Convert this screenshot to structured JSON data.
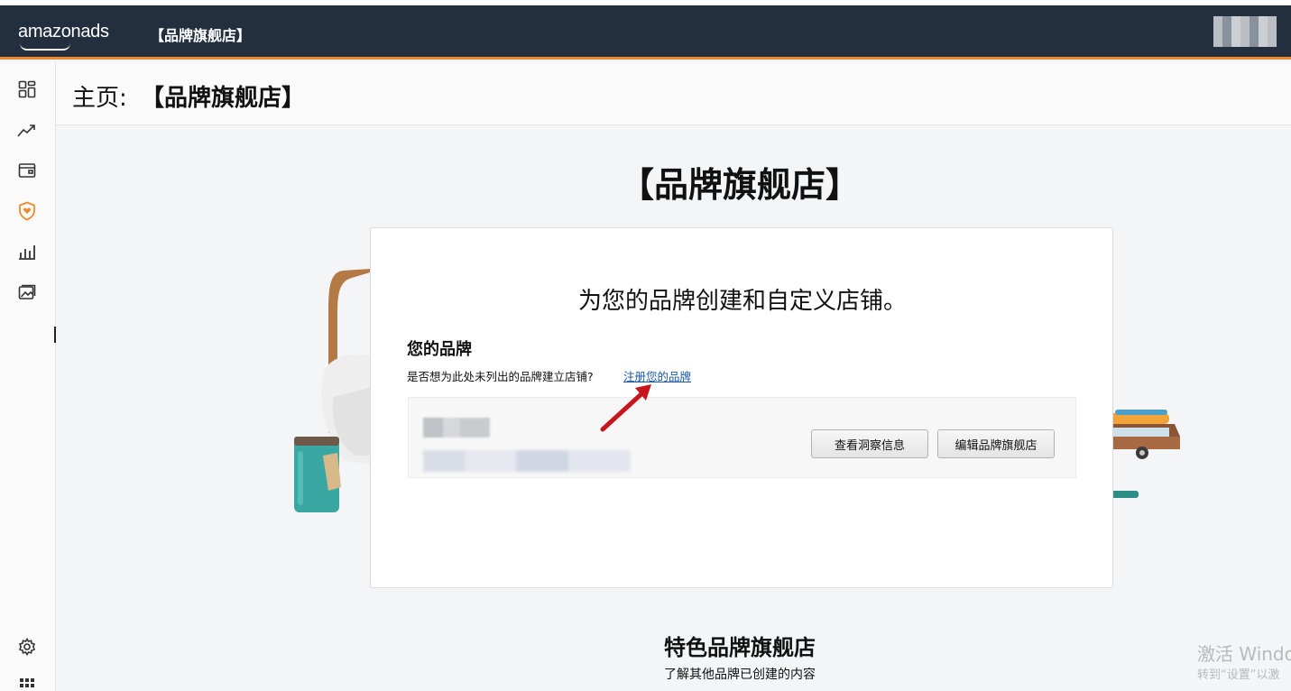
{
  "topbar": {
    "logo_text": "amazonads",
    "store_title": "【品牌旗舰店】",
    "accent_color": "#f08a2a",
    "bar_color": "#232f3e"
  },
  "sidebar": {
    "items": [
      {
        "icon": "dashboard-icon"
      },
      {
        "icon": "trend-chart-icon"
      },
      {
        "icon": "wallet-icon"
      },
      {
        "icon": "brand-shield-icon",
        "active": true
      },
      {
        "icon": "bar-chart-icon"
      },
      {
        "icon": "media-gallery-icon"
      }
    ],
    "bottom_items": [
      {
        "icon": "gear-icon"
      },
      {
        "icon": "apps-grid-icon"
      }
    ]
  },
  "page_header": {
    "prefix": "主页:",
    "name": "【品牌旗舰店】"
  },
  "hero": {
    "title": "【品牌旗舰店】"
  },
  "card": {
    "title": "为您的品牌创建和自定义店铺。",
    "brand_heading": "您的品牌",
    "question": "是否想为此处未列出的品牌建立店铺?",
    "register_link": "注册您的品牌",
    "buttons": {
      "insights": "查看洞察信息",
      "edit_store": "编辑品牌旗舰店"
    }
  },
  "featured": {
    "title": "特色品牌旗舰店",
    "subtitle": "了解其他品牌已创建的内容"
  },
  "watermark": {
    "line1": "激活 Windo",
    "line2": "转到“设置”以激"
  }
}
